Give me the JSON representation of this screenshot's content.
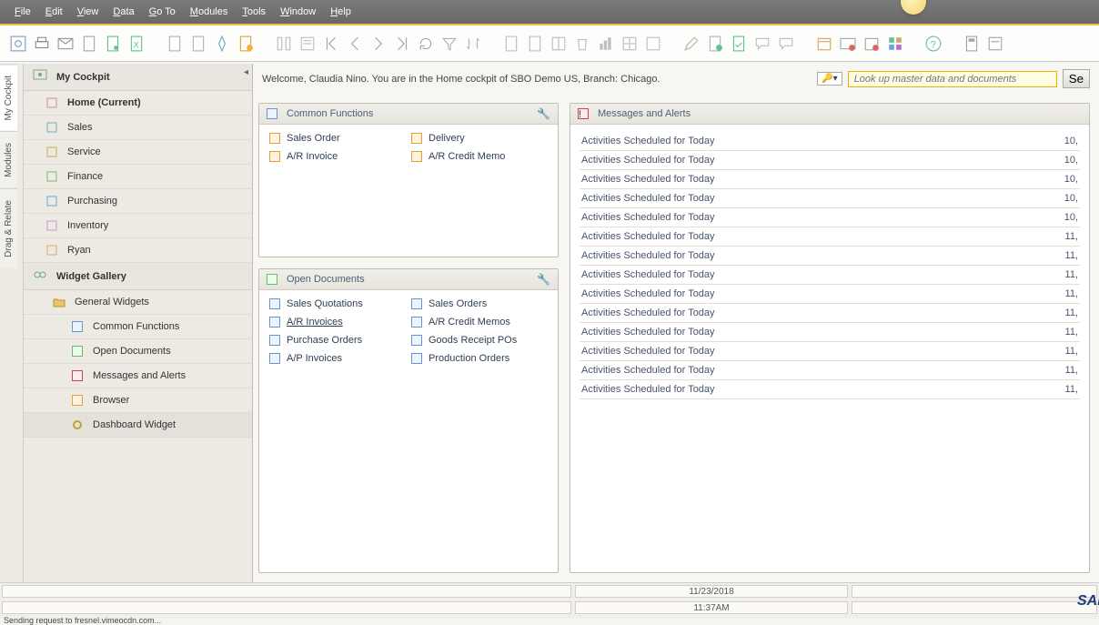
{
  "menu": {
    "file": "File",
    "edit": "Edit",
    "view": "View",
    "data": "Data",
    "goto": "Go To",
    "modules": "Modules",
    "tools": "Tools",
    "window": "Window",
    "help": "Help"
  },
  "vtabs": {
    "cockpit": "My Cockpit",
    "modules": "Modules",
    "drag": "Drag & Relate"
  },
  "sidebar": {
    "cockpit_header": "My Cockpit",
    "items": [
      {
        "label": "Home (Current)"
      },
      {
        "label": "Sales"
      },
      {
        "label": "Service"
      },
      {
        "label": "Finance"
      },
      {
        "label": "Purchasing"
      },
      {
        "label": "Inventory"
      },
      {
        "label": "Ryan"
      }
    ],
    "gallery_header": "Widget Gallery",
    "general": "General Widgets",
    "widgets": [
      {
        "label": "Common Functions"
      },
      {
        "label": "Open Documents"
      },
      {
        "label": "Messages and Alerts"
      },
      {
        "label": "Browser"
      },
      {
        "label": "Dashboard Widget"
      }
    ]
  },
  "welcome": "Welcome, Claudia Nino. You are in the Home cockpit of SBO Demo US, Branch: Chicago.",
  "search": {
    "placeholder": "Look up master data and documents",
    "button": "Se"
  },
  "panels": {
    "common": {
      "title": "Common Functions",
      "items": [
        {
          "l": "Sales Order",
          "r": "Delivery"
        },
        {
          "l": "A/R Invoice",
          "r": "A/R Credit Memo"
        }
      ]
    },
    "open": {
      "title": "Open Documents",
      "items": [
        {
          "l": "Sales Quotations",
          "r": "Sales Orders"
        },
        {
          "l": "A/R Invoices",
          "r": "A/R Credit Memos",
          "lu": true
        },
        {
          "l": "Purchase Orders",
          "r": "Goods Receipt POs"
        },
        {
          "l": "A/P Invoices",
          "r": "Production Orders"
        }
      ]
    },
    "alerts": {
      "title": "Messages and Alerts",
      "rows": [
        {
          "t": "Activities Scheduled for Today",
          "n": "10,"
        },
        {
          "t": "Activities Scheduled for Today",
          "n": "10,"
        },
        {
          "t": "Activities Scheduled for Today",
          "n": "10,"
        },
        {
          "t": "Activities Scheduled for Today",
          "n": "10,"
        },
        {
          "t": "Activities Scheduled for Today",
          "n": "10,"
        },
        {
          "t": "Activities Scheduled for Today",
          "n": "11,"
        },
        {
          "t": "Activities Scheduled for Today",
          "n": "11,"
        },
        {
          "t": "Activities Scheduled for Today",
          "n": "11,"
        },
        {
          "t": "Activities Scheduled for Today",
          "n": "11,"
        },
        {
          "t": "Activities Scheduled for Today",
          "n": "11,"
        },
        {
          "t": "Activities Scheduled for Today",
          "n": "11,"
        },
        {
          "t": "Activities Scheduled for Today",
          "n": "11,"
        },
        {
          "t": "Activities Scheduled for Today",
          "n": "11,"
        },
        {
          "t": "Activities Scheduled for Today",
          "n": "11,"
        }
      ]
    }
  },
  "status": {
    "date": "11/23/2018",
    "time": "11:37AM",
    "msg": "Sending request to fresnel.vimeocdn.com..."
  }
}
